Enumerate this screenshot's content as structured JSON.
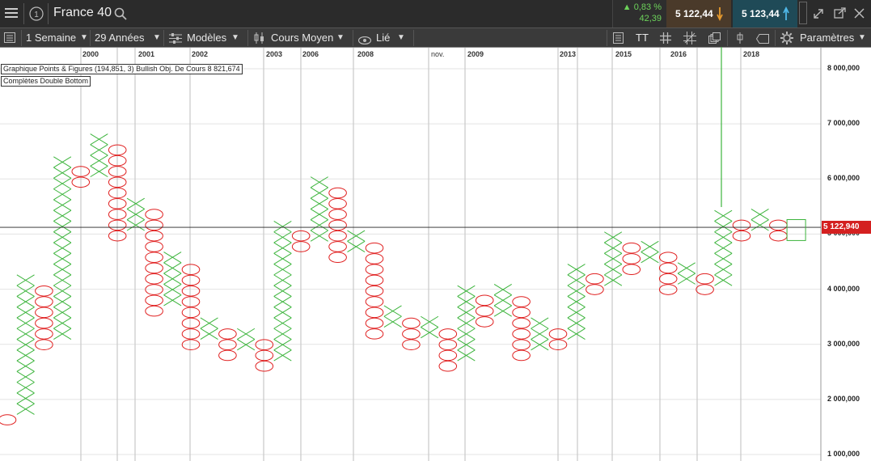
{
  "header": {
    "title": "France 40",
    "change_pct": "▲ 0,83 %",
    "change_abs": "42,39",
    "sell_price": "5 122,44",
    "buy_price": "5 123,44"
  },
  "toolbar": {
    "period": "1 Semaine",
    "range": "29 Années",
    "models": "Modèles",
    "price_type": "Cours Moyen",
    "link": "Lié",
    "text_tool": "TT",
    "params": "Paramètres"
  },
  "annotations": {
    "line1": "Graphique Points & Figures (194,851, 3)    Bullish Obj. De Cours 8 821,674",
    "line2": "Complètes Double Bottom"
  },
  "colors": {
    "x_color": "#3cb43c",
    "o_color": "#e02020",
    "price_tag": "#d42020",
    "up_arrow": "#e69a2e",
    "down_arrow": "#4fb8e8"
  },
  "price_tag": "5 122,940",
  "chart_data": {
    "type": "point-and-figure",
    "box_size": 194851,
    "reversal": 3,
    "current_price": 5122940,
    "y_range": [
      1000000,
      8200000
    ],
    "y_ticks": [
      "8 000,000",
      "7 000,000",
      "6 000,000",
      "5 000,000",
      "4 000,000",
      "3 000,000",
      "2 000,000",
      "1 000,000"
    ],
    "x_labels": [
      "2000",
      "2001",
      "2002",
      "2003",
      "2006",
      "2008",
      "nov.",
      "2009",
      "2013",
      "2015",
      "2016",
      "2018"
    ],
    "columns": [
      {
        "type": "O",
        "low": 1532000,
        "high": 1727000
      },
      {
        "type": "X",
        "low": 1727000,
        "high": 4260000
      },
      {
        "type": "O",
        "low": 2896000,
        "high": 4065000
      },
      {
        "type": "X",
        "low": 3091000,
        "high": 6429000
      },
      {
        "type": "O",
        "low": 5844000,
        "high": 6234000
      },
      {
        "type": "X",
        "low": 6039000,
        "high": 6819000
      },
      {
        "type": "O",
        "low": 4870000,
        "high": 6624000
      },
      {
        "type": "X",
        "low": 5065000,
        "high": 5649000
      },
      {
        "type": "O",
        "low": 3506000,
        "high": 5454000
      },
      {
        "type": "X",
        "low": 3701000,
        "high": 4675000
      },
      {
        "type": "O",
        "low": 2896000,
        "high": 4480000
      },
      {
        "type": "X",
        "low": 3091000,
        "high": 3506000
      },
      {
        "type": "O",
        "low": 2701000,
        "high": 3311000
      },
      {
        "type": "X",
        "low": 2896000,
        "high": 3311000
      },
      {
        "type": "O",
        "low": 2506000,
        "high": 3116000
      },
      {
        "type": "X",
        "low": 2701000,
        "high": 5259000
      },
      {
        "type": "O",
        "low": 4675000,
        "high": 5065000
      },
      {
        "type": "X",
        "low": 4870000,
        "high": 6039000
      },
      {
        "type": "O",
        "low": 4480000,
        "high": 5844000
      },
      {
        "type": "X",
        "low": 4675000,
        "high": 5064000
      },
      {
        "type": "O",
        "low": 3091000,
        "high": 4870000
      },
      {
        "type": "X",
        "low": 3311000,
        "high": 3701000
      },
      {
        "type": "O",
        "low": 2896000,
        "high": 3506000
      },
      {
        "type": "X",
        "low": 3116000,
        "high": 3506000
      },
      {
        "type": "O",
        "low": 2506000,
        "high": 3311000
      },
      {
        "type": "X",
        "low": 2701000,
        "high": 4065000
      },
      {
        "type": "O",
        "low": 3311000,
        "high": 3896000
      },
      {
        "type": "X",
        "low": 3506000,
        "high": 4065000
      },
      {
        "type": "O",
        "low": 2701000,
        "high": 3896000
      },
      {
        "type": "X",
        "low": 2896000,
        "high": 3506000
      },
      {
        "type": "O",
        "low": 2896000,
        "high": 3311000
      },
      {
        "type": "X",
        "low": 3091000,
        "high": 4455000
      },
      {
        "type": "O",
        "low": 3896000,
        "high": 4260000
      },
      {
        "type": "X",
        "low": 4065000,
        "high": 5064000
      },
      {
        "type": "O",
        "low": 4260000,
        "high": 4870000
      },
      {
        "type": "X",
        "low": 4480000,
        "high": 4870000
      },
      {
        "type": "O",
        "low": 3896000,
        "high": 4675000
      },
      {
        "type": "X",
        "low": 4091000,
        "high": 4480000
      },
      {
        "type": "O",
        "low": 3896000,
        "high": 4260000
      },
      {
        "type": "X",
        "low": 4065000,
        "high": 5454000
      },
      {
        "type": "O",
        "low": 4870000,
        "high": 5259000
      },
      {
        "type": "X",
        "low": 5065000,
        "high": 5454000
      },
      {
        "type": "O",
        "low": 4870000,
        "high": 5259000
      }
    ]
  }
}
